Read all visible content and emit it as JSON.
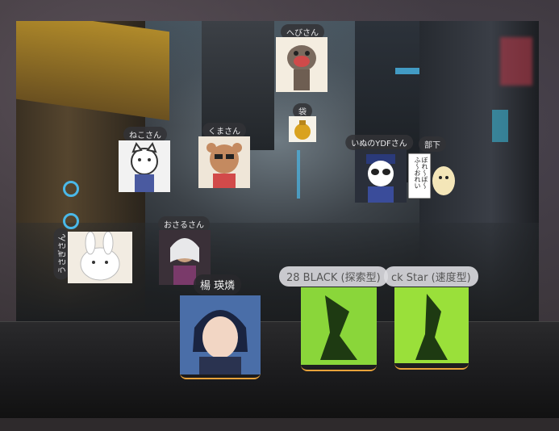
{
  "scene": {
    "avatars": [
      {
        "id": "hebi",
        "name": "へびさん",
        "icon": "snake-avatar"
      },
      {
        "id": "bag",
        "name": "袋",
        "icon": "gold-bag-avatar"
      },
      {
        "id": "neko",
        "name": "ねこさん",
        "icon": "cat-avatar"
      },
      {
        "id": "kuma",
        "name": "くまさん",
        "icon": "bear-avatar"
      },
      {
        "id": "inu",
        "name": "いぬのYDFさん",
        "icon": "police-dog-avatar"
      },
      {
        "id": "buka",
        "name": "部下",
        "icon": "hamster-avatar"
      },
      {
        "id": "osaru",
        "name": "おさるさん",
        "icon": "monkey-avatar"
      },
      {
        "id": "usagi",
        "name": "うさぎさん",
        "icon": "rabbit-avatar"
      }
    ],
    "bubble_text": "ぼれ〜ぼ〜ふ〜おれい"
  },
  "stage": {
    "speaker_name": "楊 瑛燐",
    "card1_label": "28 BLACK (探索型)",
    "card2_label": "ck Star (速度型)"
  },
  "colors": {
    "accent": "#e8a23a",
    "tag_bg": "#323236",
    "neon": "#4ab8e8"
  }
}
